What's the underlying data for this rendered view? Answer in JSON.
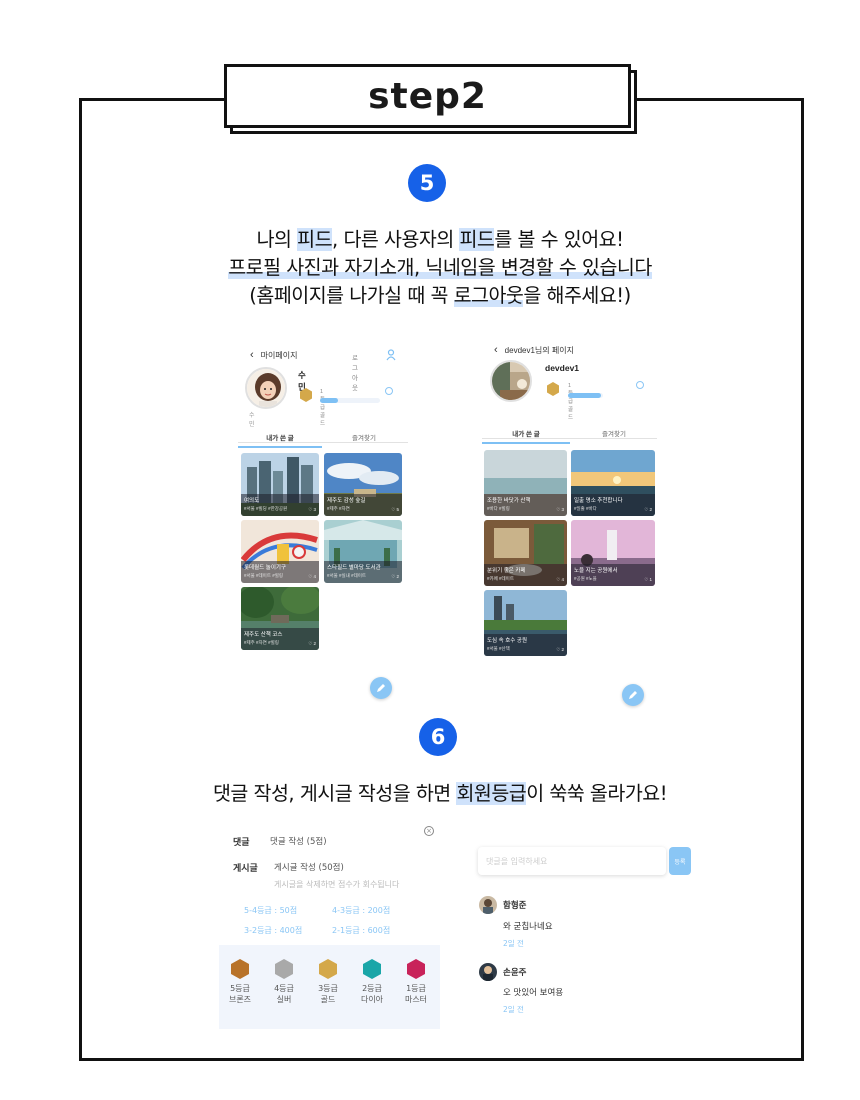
{
  "step_title": "step2",
  "section5": {
    "number": "5",
    "line1": {
      "p1": "나의 ",
      "h1": "피드",
      "p2": ", 다른 사용자의 ",
      "h2": "피드",
      "p3": "를 볼 수 있어요!"
    },
    "line2": {
      "u1": "프로필 사진과 자기소개, 닉네임을 변경할 수 있습니다"
    },
    "line3": {
      "p1": "(홈페이지를 나가실 때 꼭 ",
      "u1": "로그아웃",
      "p2": "을 해주세요!)"
    }
  },
  "my_page": {
    "title": "마이페이지",
    "logout": "로그아웃",
    "nickname": "수민",
    "intro": "수민",
    "grade_label": "1등급 골드",
    "grade_progress": 0.3,
    "tab_active": "내가 쓴 글",
    "tab_other": "즐겨찾기",
    "posts": [
      {
        "title": "여의도",
        "tags": "#서울 #빌딩 #한강공원",
        "likes": "♡ 3"
      },
      {
        "title": "제주도 감성 숲길",
        "tags": "#제주 #자연",
        "likes": "♡ 5"
      },
      {
        "title": "롯데월드 놀이기구",
        "tags": "#서울 #데이트 #힐링",
        "likes": "♡ 4"
      },
      {
        "title": "스타필드 별마당 도서관",
        "tags": "#서울 #실내 #데이트",
        "likes": "♡ 2"
      },
      {
        "title": "제주도 산책 코스",
        "tags": "#제주 #자연 #힐링",
        "likes": "♡ 2"
      }
    ]
  },
  "other_page": {
    "title": "devdev1님의 페이지",
    "nickname": "devdev1",
    "grade_label": "1등급 골드",
    "grade_progress": 0.95,
    "tab_active": "내가 쓴 글",
    "tab_other": "즐겨찾기",
    "posts": [
      {
        "title": "조용한 바닷가 산책",
        "tags": "#바다 #힐링",
        "likes": "♡ 3"
      },
      {
        "title": "일출 명소 추천합니다",
        "tags": "#일출 #바다",
        "likes": "♡ 2"
      },
      {
        "title": "분위기 좋은 카페",
        "tags": "#카페 #데이트",
        "likes": "♡ 4"
      },
      {
        "title": "노을 지는 공원에서",
        "tags": "#공원 #노을",
        "likes": "♡ 1"
      },
      {
        "title": "도심 속 호수 공원",
        "tags": "#서울 #산책",
        "likes": "♡ 2"
      }
    ]
  },
  "section6": {
    "number": "6",
    "p1": "댓글 작성, 게시글 작성을 하면 ",
    "h1": "회원등급",
    "p2": "이 쑥쑥 올라가요!"
  },
  "grade_panel": {
    "comment_label": "댓글",
    "comment_text": "댓글 작성 (5점)",
    "post_label": "게시글",
    "post_text": "게시글 작성 (50점)",
    "post_note": "게시글을 삭제하면 점수가 회수됩니다",
    "req1": "5-4등급 : 50점",
    "req2": "4-3등급 : 200점",
    "req3": "3-2등급 : 400점",
    "req4": "2-1등급 : 600점",
    "grades": [
      {
        "rank": "5등급",
        "name": "브론즈",
        "color": "#b8732a"
      },
      {
        "rank": "4등급",
        "name": "실버",
        "color": "#a9a9a9"
      },
      {
        "rank": "3등급",
        "name": "골드",
        "color": "#d4a84a"
      },
      {
        "rank": "2등급",
        "name": "다이아",
        "color": "#1aa6a8"
      },
      {
        "rank": "1등급",
        "name": "마스터",
        "color": "#c8235a"
      }
    ]
  },
  "comments_panel": {
    "placeholder": "댓글을 입력하세요",
    "submit": "등록",
    "comments": [
      {
        "name": "함형준",
        "text": "와 굳칩나네요",
        "time": "2일 전"
      },
      {
        "name": "손윤주",
        "text": "오 맛있어 보여용",
        "time": "2일 전"
      }
    ]
  }
}
